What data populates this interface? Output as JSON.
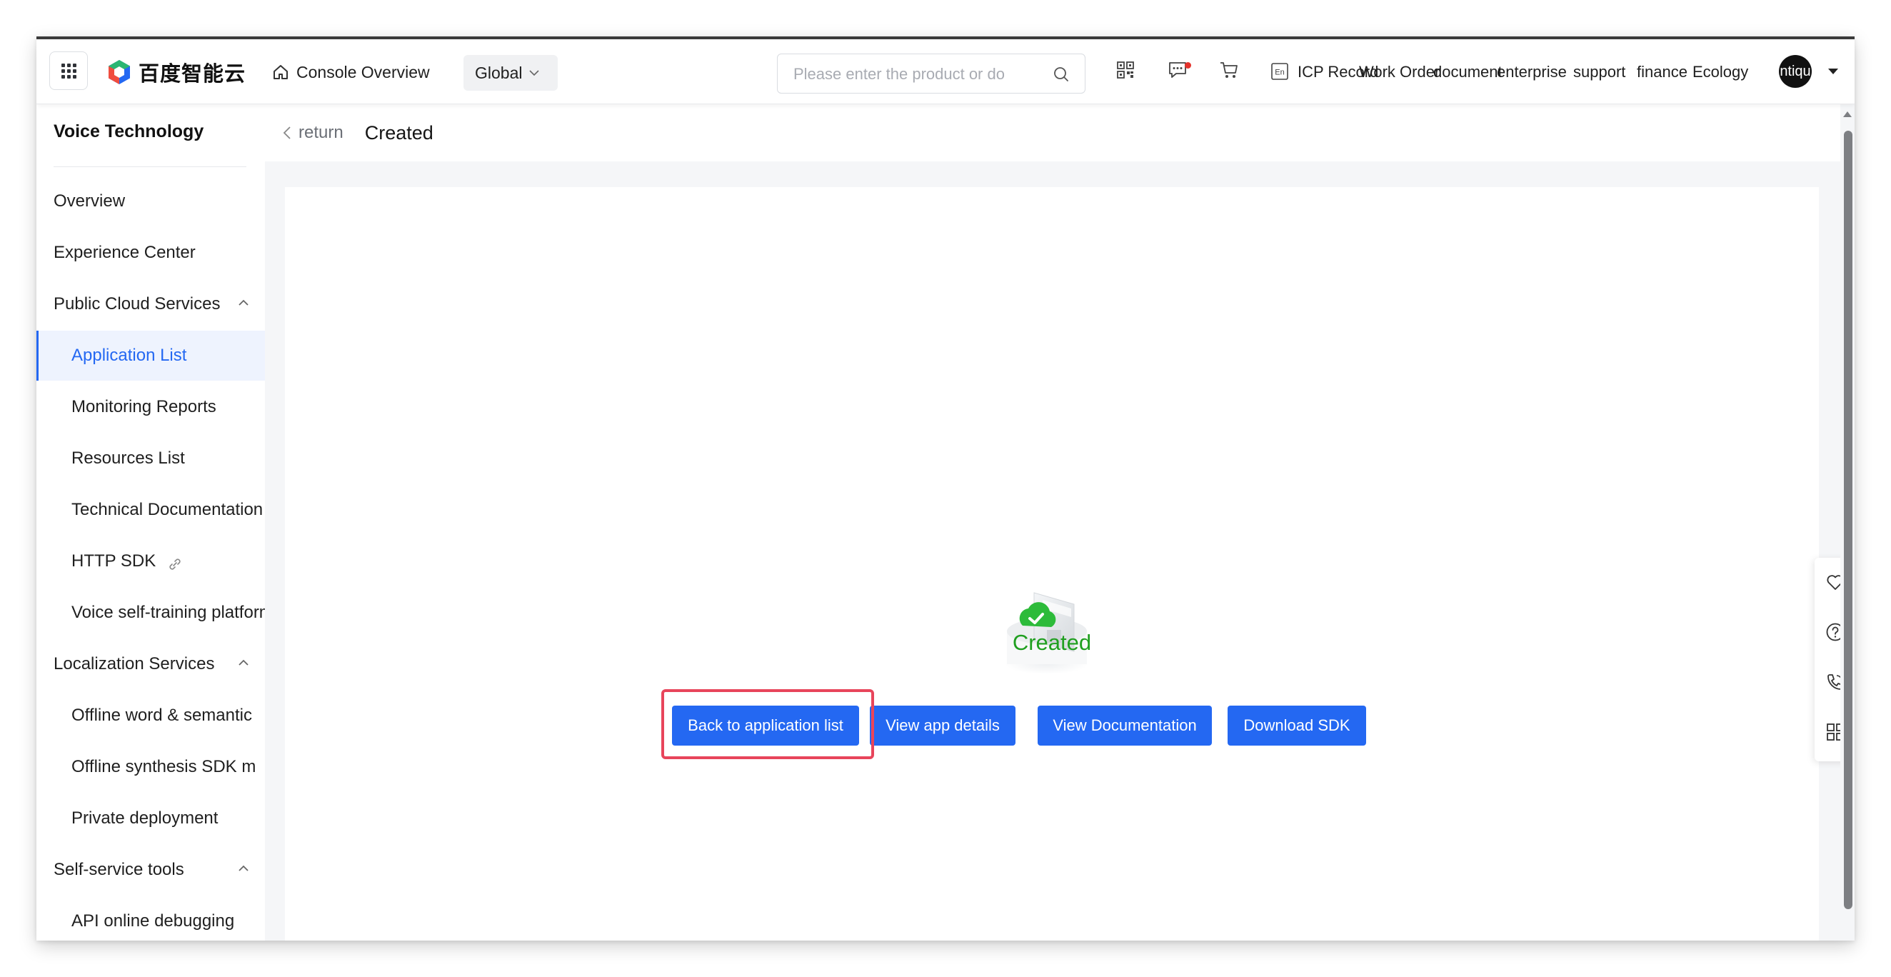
{
  "topbar": {
    "logo_text": "百度智能云",
    "console_overview": "Console Overview",
    "region": "Global",
    "search_placeholder": "Please enter the product or do",
    "links": {
      "icp": "ICP Record",
      "work_order": "Work Order",
      "document": "document",
      "enterprise": "enterprise",
      "support": "support",
      "finance": "finance",
      "ecology": "Ecology"
    },
    "avatar_text": "ntiqu",
    "icons": [
      "qr-code-icon",
      "message-icon",
      "cart-icon",
      "language-en-icon"
    ]
  },
  "sidebar": {
    "title": "Voice Technology",
    "items": [
      {
        "label": "Overview"
      },
      {
        "label": "Experience Center"
      },
      {
        "label": "Public Cloud Services"
      },
      {
        "label": "Application List"
      },
      {
        "label": "Monitoring Reports"
      },
      {
        "label": "Resources List"
      },
      {
        "label": "Technical Documentation"
      },
      {
        "label": "HTTP SDK"
      },
      {
        "label": "Voice self-training platform"
      },
      {
        "label": "Localization Services"
      },
      {
        "label": "Offline word & semantic"
      },
      {
        "label": "Offline synthesis SDK m"
      },
      {
        "label": "Private deployment"
      },
      {
        "label": "Self-service tools"
      },
      {
        "label": "API online debugging"
      }
    ]
  },
  "main": {
    "return_label": "return",
    "page_title": "Created",
    "status_text": "Created",
    "buttons": {
      "back": "Back to application list",
      "details": "View app details",
      "docs": "View Documentation",
      "sdk": "Download SDK"
    }
  },
  "colors": {
    "accent": "#2468f2",
    "success": "#1f9f1f",
    "highlight": "#e8455b",
    "notification_dot": "#e4322b"
  }
}
